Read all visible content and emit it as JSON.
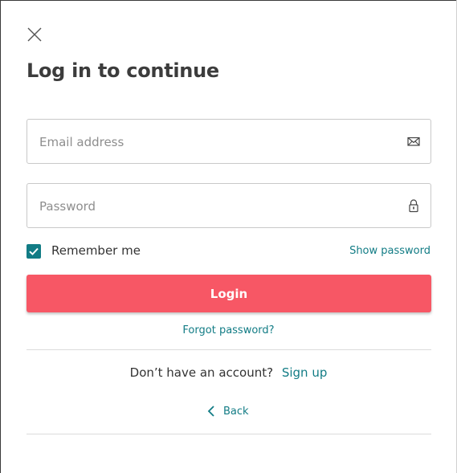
{
  "dialog": {
    "title": "Log in to continue",
    "close_icon": "close-icon"
  },
  "email": {
    "placeholder": "Email address",
    "value": "",
    "icon": "envelope-icon"
  },
  "password": {
    "placeholder": "Password",
    "value": "",
    "icon": "lock-icon"
  },
  "remember": {
    "label": "Remember me",
    "checked": true
  },
  "show_password_label": "Show password",
  "login_label": "Login",
  "forgot_label": "Forgot password?",
  "signup": {
    "question": "Don’t have an account?",
    "link": "Sign up"
  },
  "back_label": "Back",
  "colors": {
    "accent": "#127c85",
    "primary_button": "#f75765",
    "title_text": "#3c3c3c",
    "border": "#c9c9c9"
  }
}
